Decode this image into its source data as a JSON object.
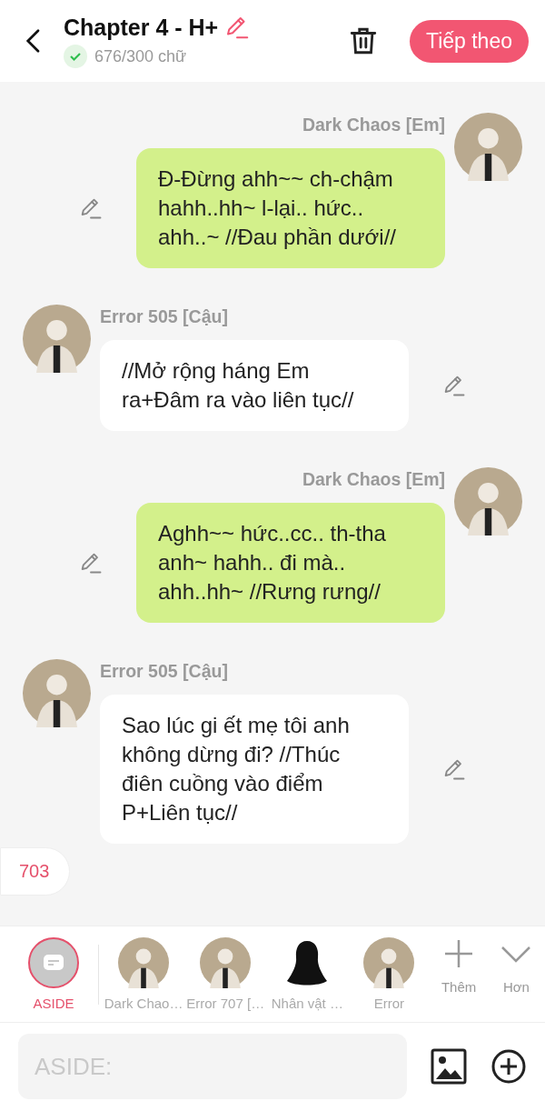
{
  "header": {
    "title": "Chapter 4 - H+",
    "word_count": "676/300 chữ",
    "next_button": "Tiếp theo"
  },
  "messages": [
    {
      "kind": "right",
      "name": "Dark Chaos [Em]",
      "text": "Đ-Đừng ahh~~ ch-chậm hahh..hh~ l-lại.. hức.. ahh..~ //Đau phần dưới//"
    },
    {
      "kind": "left",
      "name": "Error 505 [Cậu]",
      "text": "//Mở rộng háng Em ra+Đâm ra vào liên tục//"
    },
    {
      "kind": "right",
      "name": "Dark Chaos [Em]",
      "text": "Aghh~~ hức..cc.. th-tha anh~ hahh.. đi mà.. ahh..hh~ //Rưng rưng//"
    },
    {
      "kind": "left",
      "name": "Error 505 [Cậu]",
      "text": "Sao lúc gi ết mẹ tôi anh không dừng đi? //Thúc điên cuồng vào điểm P+Liên tục//"
    }
  ],
  "counter": "703",
  "cast": [
    {
      "kind": "aside",
      "label": "ASIDE",
      "selected": true
    },
    {
      "kind": "avatar",
      "label": "Dark Chao…",
      "selected": false
    },
    {
      "kind": "avatar",
      "label": "Error 707 […",
      "selected": false
    },
    {
      "kind": "silhouette",
      "label": "Nhân vật …",
      "selected": false
    },
    {
      "kind": "avatar",
      "label": "Error",
      "selected": false
    }
  ],
  "cast_actions": [
    {
      "kind": "add",
      "label": "Thêm"
    },
    {
      "kind": "more",
      "label": "Hơn"
    }
  ],
  "input": {
    "placeholder": "ASIDE:"
  }
}
